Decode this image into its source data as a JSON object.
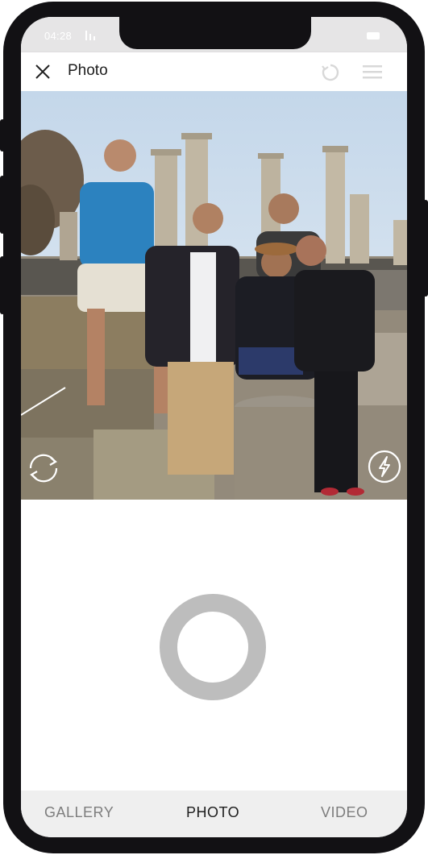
{
  "status_bar": {
    "time": "04:28",
    "signal_icon": "signal-icon",
    "battery_icon": "battery-icon"
  },
  "top_bar": {
    "title": "Photo",
    "close_icon": "close-icon",
    "reload_icon": "reload-icon",
    "menu_icon": "menu-icon"
  },
  "viewfinder": {
    "switch_camera_icon": "switch-camera-icon",
    "flash_icon": "flash-icon"
  },
  "shutter": {
    "icon": "shutter-ring-icon",
    "color": "#bdbdbd"
  },
  "modes": {
    "tabs": [
      {
        "label": "GALLERY"
      },
      {
        "label": "PHOTO"
      },
      {
        "label": "VIDEO"
      }
    ],
    "active": "PHOTO"
  },
  "colors": {
    "frame": "#121114",
    "status_bar": "#e6e5e6",
    "mode_bar": "#efefef",
    "active_tab": "#1e1e1e",
    "inactive_tab": "#7d7d7d"
  }
}
